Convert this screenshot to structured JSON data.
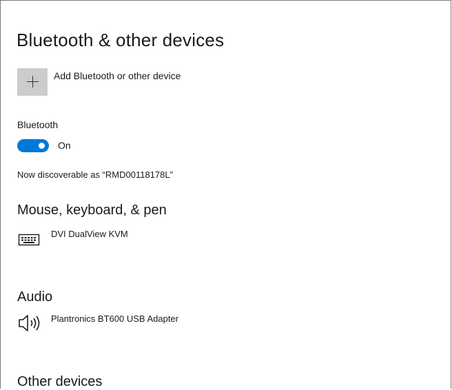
{
  "page": {
    "title": "Bluetooth & other devices"
  },
  "add_device": {
    "label": "Add Bluetooth or other device",
    "icon": "plus-icon"
  },
  "bluetooth": {
    "label": "Bluetooth",
    "toggle_on": true,
    "state_label": "On",
    "discoverable_text": "Now discoverable as “RMD00118178L”"
  },
  "sections": {
    "mouse_keyboard_pen": {
      "heading": "Mouse, keyboard, & pen",
      "devices": [
        {
          "name": "DVI DualView KVM",
          "icon": "keyboard-icon"
        }
      ]
    },
    "audio": {
      "heading": "Audio",
      "devices": [
        {
          "name": "Plantronics BT600 USB Adapter",
          "icon": "speaker-icon"
        }
      ]
    },
    "other_devices": {
      "heading": "Other devices"
    }
  },
  "colors": {
    "accent": "#0078d7",
    "add_button_bg": "#cccccc",
    "text": "#1a1a1a"
  }
}
